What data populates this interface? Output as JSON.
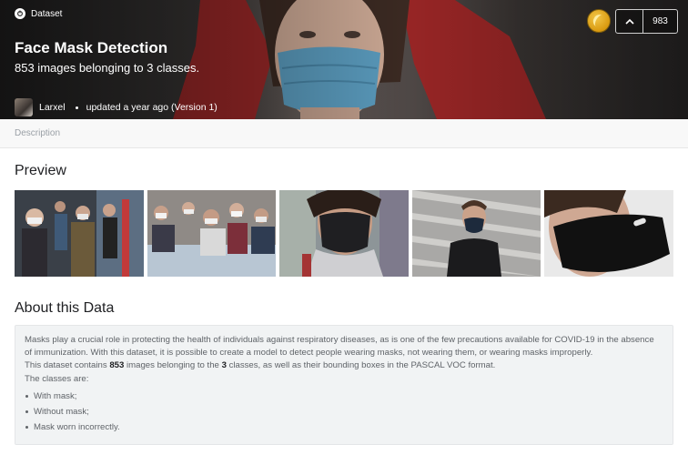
{
  "header": {
    "type_label": "Dataset",
    "title": "Face Mask Detection",
    "subtitle": "853 images belonging to 3 classes.",
    "owner": "Larxel",
    "updated": "updated a year ago (Version 1)",
    "medal_icon": "gold-medal-icon",
    "upvote_icon": "chevron-up-icon",
    "vote_count": "983"
  },
  "tabs": [
    {
      "label": "Description"
    }
  ],
  "preview": {
    "heading": "Preview",
    "images": [
      {
        "icon": "crowd-masks-photo"
      },
      {
        "icon": "crowd-masks-photo"
      },
      {
        "icon": "person-black-mask-photo"
      },
      {
        "icon": "man-mask-stairs-photo"
      },
      {
        "icon": "black-mask-closeup-photo"
      }
    ]
  },
  "about": {
    "heading": "About this Data",
    "intro_1": "Masks play a crucial role in protecting the health of individuals against respiratory diseases, as is one of the few precautions available for COVID-19 in the absence of immunization. With this dataset, it is possible to create a model to detect people wearing masks, not wearing them, or wearing masks improperly.",
    "intro_2a": "This dataset contains ",
    "image_count": "853",
    "intro_2b": " images belonging to the ",
    "class_count": "3",
    "intro_2c": " classes, as well as their bounding boxes in the PASCAL VOC format.",
    "classes_label": "The classes are:",
    "classes": [
      "With mask;",
      "Without mask;",
      "Mask worn incorrectly."
    ]
  },
  "colors": {
    "accent_medal": "#e0a81e",
    "text_primary": "#202124",
    "text_muted": "#5f6368"
  }
}
